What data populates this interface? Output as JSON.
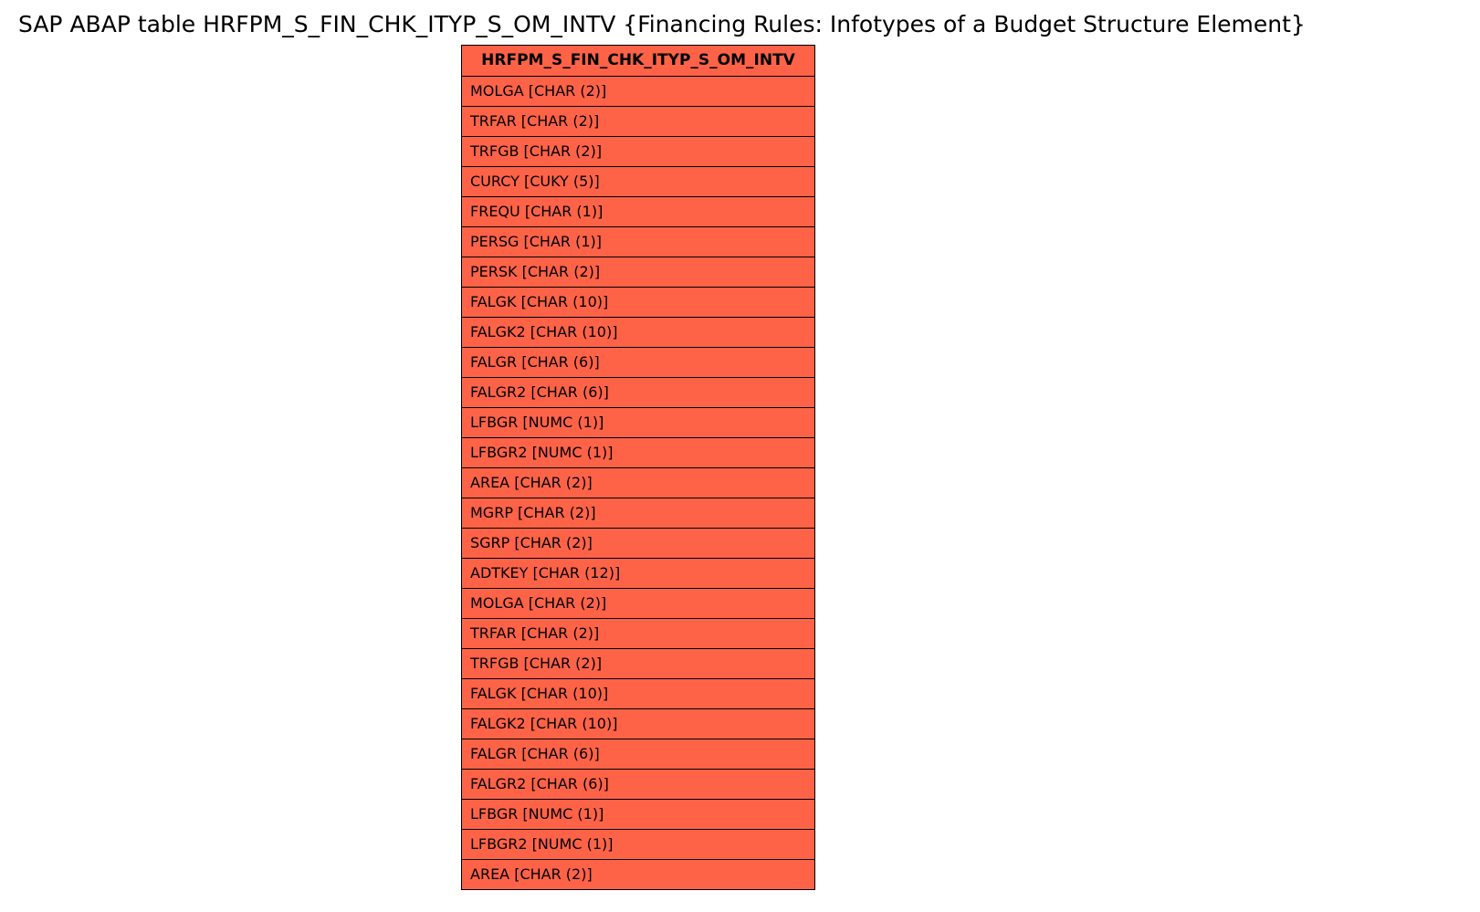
{
  "title": {
    "prefix": "SAP ABAP table ",
    "table_name": "HRFPM_S_FIN_CHK_ITYP_S_OM_INTV",
    "description_braced": " {Financing Rules: Infotypes of a Budget Structure Element}"
  },
  "table": {
    "header": "HRFPM_S_FIN_CHK_ITYP_S_OM_INTV",
    "rows": [
      "MOLGA [CHAR (2)]",
      "TRFAR [CHAR (2)]",
      "TRFGB [CHAR (2)]",
      "CURCY [CUKY (5)]",
      "FREQU [CHAR (1)]",
      "PERSG [CHAR (1)]",
      "PERSK [CHAR (2)]",
      "FALGK [CHAR (10)]",
      "FALGK2 [CHAR (10)]",
      "FALGR [CHAR (6)]",
      "FALGR2 [CHAR (6)]",
      "LFBGR [NUMC (1)]",
      "LFBGR2 [NUMC (1)]",
      "AREA [CHAR (2)]",
      "MGRP [CHAR (2)]",
      "SGRP [CHAR (2)]",
      "ADTKEY [CHAR (12)]",
      "MOLGA [CHAR (2)]",
      "TRFAR [CHAR (2)]",
      "TRFGB [CHAR (2)]",
      "FALGK [CHAR (10)]",
      "FALGK2 [CHAR (10)]",
      "FALGR [CHAR (6)]",
      "FALGR2 [CHAR (6)]",
      "LFBGR [NUMC (1)]",
      "LFBGR2 [NUMC (1)]",
      "AREA [CHAR (2)]"
    ]
  }
}
